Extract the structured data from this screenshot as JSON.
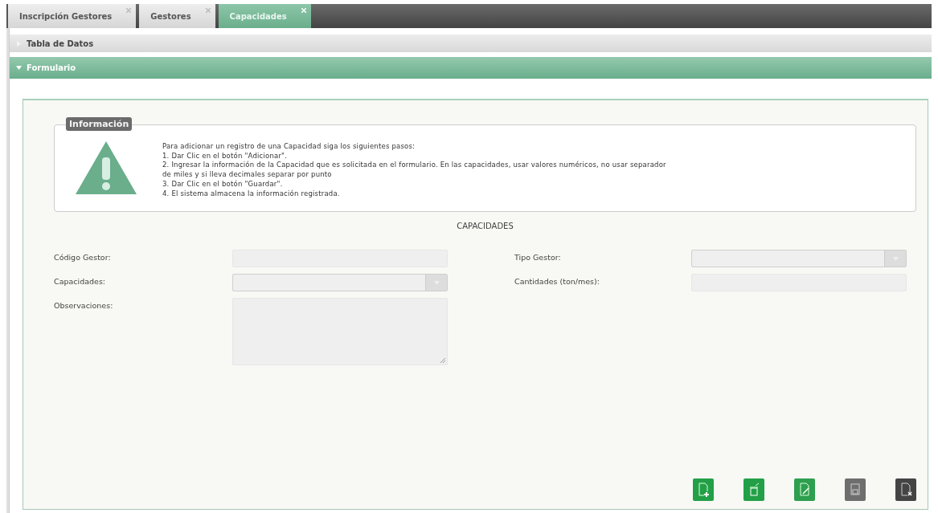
{
  "tabs": [
    {
      "label": "Inscripción Gestores",
      "selected": false
    },
    {
      "label": "Gestores",
      "selected": false
    },
    {
      "label": "Capacidades",
      "selected": true
    }
  ],
  "sections": [
    {
      "title": "Tabla de Datos",
      "expanded": false
    },
    {
      "title": "Formulario",
      "expanded": true
    }
  ],
  "info": {
    "title": "Información",
    "lines": [
      "Para adicionar un registro de una Capacidad siga los siguientes pasos:",
      "1. Dar Clic en el botón \"Adicionar\".",
      "2. Ingresar la información de la Capacidad que es solicitada en el formulario. En las capacidades, usar valores numéricos, no usar separador",
      "de miles y si lleva decimales separar por punto",
      "3. Dar Clic en el botón \"Guardar\".",
      "4. El sistema almacena la información registrada."
    ]
  },
  "form": {
    "title": "CAPACIDADES",
    "left_fields": [
      {
        "label": "Código Gestor:",
        "kind": "text"
      },
      {
        "label": "Capacidades:",
        "kind": "select"
      },
      {
        "label": "Observaciones:",
        "kind": "textarea"
      }
    ],
    "right_fields": [
      {
        "label": "Tipo Gestor:",
        "kind": "select"
      },
      {
        "label": "Cantidades (ton/mes):",
        "kind": "text"
      }
    ]
  },
  "buttons": [
    {
      "kind": "add",
      "disabled": false
    },
    {
      "kind": "delete",
      "disabled": false
    },
    {
      "kind": "edit",
      "disabled": false
    },
    {
      "kind": "save",
      "disabled": true
    },
    {
      "kind": "cancel",
      "disabled": true
    }
  ]
}
